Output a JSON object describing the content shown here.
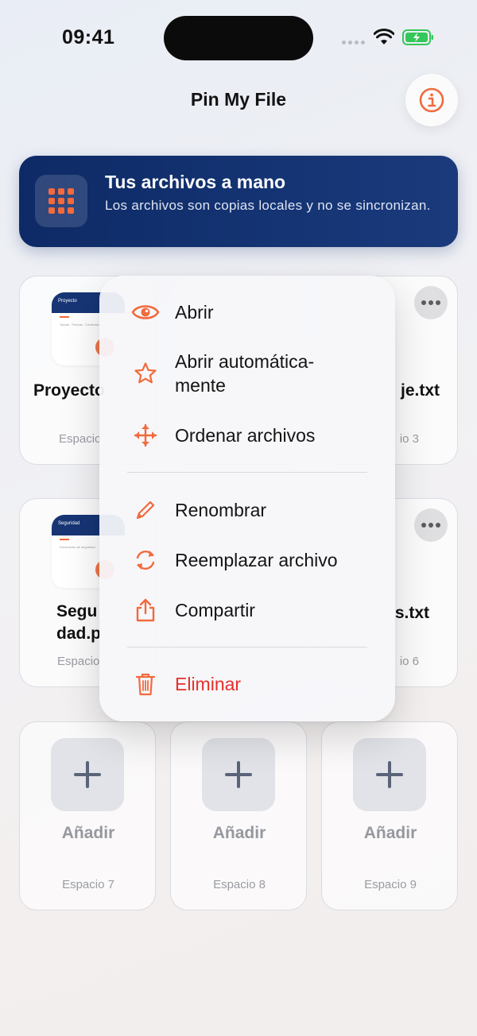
{
  "status_bar": {
    "time": "09:41"
  },
  "header": {
    "title": "Pin My File"
  },
  "banner": {
    "title": "Tus archivos a mano",
    "subtitle": "Los archivos son copias locales y no se sincronizan."
  },
  "tiles": [
    {
      "name": "Proyecto",
      "space": "Espacio",
      "thumb_title": "Proyecto",
      "thumb_sub": "Tareas · Fechas · Contenidos"
    },
    {
      "name": "je.txt",
      "space": "io 3"
    },
    {
      "name_line1": "Segu",
      "name_line2": "dad.p",
      "space": "Espacio",
      "thumb_title": "Seguridad",
      "thumb_sub": "Documento de seguridad"
    },
    {
      "name": "s.txt",
      "space": "io 6"
    }
  ],
  "add_slots": [
    {
      "label": "Añadir",
      "space": "Espacio 7"
    },
    {
      "label": "Añadir",
      "space": "Espacio 8"
    },
    {
      "label": "Añadir",
      "space": "Espacio 9"
    }
  ],
  "menu": {
    "open": "Abrir",
    "auto_open_line1": "Abrir automática-",
    "auto_open_line2": "mente",
    "sort": "Ordenar archivos",
    "rename": "Renombrar",
    "replace": "Reemplazar archivo",
    "share": "Compartir",
    "delete": "Eliminar"
  },
  "colors": {
    "accent": "#f26a3d",
    "banner": "#0e2a66",
    "danger": "#e5302b"
  },
  "icons": [
    "info-icon",
    "grid-icon",
    "eye-icon",
    "star-icon",
    "move-icon",
    "pencil-icon",
    "refresh-icon",
    "share-icon",
    "trash-icon",
    "plus-icon",
    "more-icon",
    "wifi-icon",
    "battery-icon"
  ]
}
